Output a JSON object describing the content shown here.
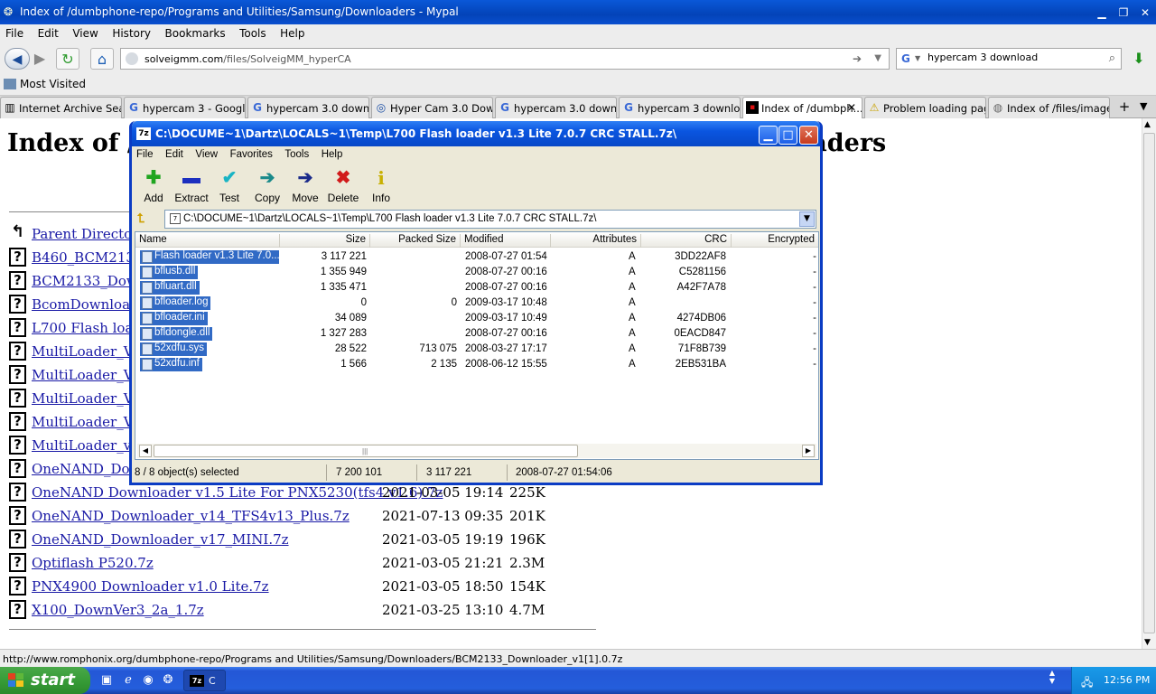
{
  "browser": {
    "title": "Index of /dumbphone-repo/Programs and Utilities/Samsung/Downloaders - Mypal",
    "menu": [
      "File",
      "Edit",
      "View",
      "History",
      "Bookmarks",
      "Tools",
      "Help"
    ],
    "url_domain": "solveigmm.com",
    "url_path": "/files/SolveigMM_hyperCA",
    "search_value": "hypercam 3 download",
    "bookmarks_label": "Most Visited",
    "tabs": [
      {
        "label": "Internet Archive Sear...",
        "icon": "archive-icon"
      },
      {
        "label": "hypercam 3 - Google ...",
        "icon": "google-icon"
      },
      {
        "label": "hypercam 3.0 downlo...",
        "icon": "google-icon"
      },
      {
        "label": "Hyper Cam 3.0 Down...",
        "icon": "site-icon"
      },
      {
        "label": "hypercam 3.0 downlo...",
        "icon": "google-icon"
      },
      {
        "label": "hypercam 3 downloa...",
        "icon": "google-icon"
      },
      {
        "label": "Index of /dumbph...",
        "icon": "site-icon",
        "active": true
      },
      {
        "label": "Problem loading page",
        "icon": "warning-icon"
      },
      {
        "label": "Index of /files/images/",
        "icon": "globe-icon"
      }
    ],
    "status_url": "http://www.romphonix.org/dumbphone-repo/Programs and Utilities/Samsung/Downloaders/BCM2133_Downloader_v1[1].0.7z"
  },
  "page": {
    "heading_left": "Index of /d",
    "heading_right": "loaders",
    "rows": [
      {
        "name": "Parent Directory",
        "date": "",
        "size": ""
      },
      {
        "name": "B460_BCM2133",
        "date": "",
        "size": ""
      },
      {
        "name": "BCM2133_Dow",
        "date": "",
        "size": ""
      },
      {
        "name": "BcomDownloade",
        "date": "",
        "size": ""
      },
      {
        "name": "L700 Flash loader",
        "date": "",
        "size": ""
      },
      {
        "name": "MultiLoader_V5.",
        "date": "",
        "size": ""
      },
      {
        "name": "MultiLoader_V5.",
        "date": "",
        "size": ""
      },
      {
        "name": "MultiLoader_V5.",
        "date": "",
        "size": ""
      },
      {
        "name": "MultiLoader_V5.",
        "date": "",
        "size": ""
      },
      {
        "name": "MultiLoader_v5.3",
        "date": "",
        "size": ""
      },
      {
        "name": "OneNAND_Dow",
        "date": "",
        "size": ""
      },
      {
        "name": "OneNAND Downloader v1.5 Lite For PNX5230(tfs4 v1.6).7z",
        "date": "2021-03-05 19:14",
        "size": "225K"
      },
      {
        "name": "OneNAND_Downloader_v14_TFS4v13_Plus.7z",
        "date": "2021-07-13 09:35",
        "size": "201K"
      },
      {
        "name": "OneNAND_Downloader_v17_MINI.7z",
        "date": "2021-03-05 19:19",
        "size": "196K"
      },
      {
        "name": "Optiflash P520.7z",
        "date": "2021-03-05 21:21",
        "size": "2.3M"
      },
      {
        "name": "PNX4900 Downloader v1.0 Lite.7z",
        "date": "2021-03-05 18:50",
        "size": "154K"
      },
      {
        "name": "X100_DownVer3_2a_1.7z",
        "date": "2021-03-25 13:10",
        "size": "4.7M"
      }
    ]
  },
  "sevenzip": {
    "title": "C:\\DOCUME~1\\Dartz\\LOCALS~1\\Temp\\L700 Flash loader v1.3 Lite 7.0.7 CRC STALL.7z\\",
    "menu": [
      "File",
      "Edit",
      "View",
      "Favorites",
      "Tools",
      "Help"
    ],
    "toolbar": [
      {
        "label": "Add",
        "icon": "plus-icon",
        "glyph": "✚",
        "color": "#1fa51f"
      },
      {
        "label": "Extract",
        "icon": "minus-icon",
        "glyph": "▬",
        "color": "#1c2fbf"
      },
      {
        "label": "Test",
        "icon": "check-icon",
        "glyph": "✔",
        "color": "#19b4c4"
      },
      {
        "label": "Copy",
        "icon": "copy-arrow-icon",
        "glyph": "➔",
        "color": "#1a8a8a"
      },
      {
        "label": "Move",
        "icon": "move-arrow-icon",
        "glyph": "➔",
        "color": "#1a2a8a"
      },
      {
        "label": "Delete",
        "icon": "delete-x-icon",
        "glyph": "✖",
        "color": "#d11a1a"
      },
      {
        "label": "Info",
        "icon": "info-icon",
        "glyph": "i",
        "color": "#c8b000"
      }
    ],
    "path": "C:\\DOCUME~1\\Dartz\\LOCALS~1\\Temp\\L700 Flash loader v1.3 Lite 7.0.7 CRC STALL.7z\\",
    "columns": [
      "Name",
      "Size",
      "Packed Size",
      "Modified",
      "Attributes",
      "CRC",
      "Encrypted"
    ],
    "files": [
      {
        "name": "Flash loader v1.3 Lite 7.0...",
        "size": "3 117 221",
        "packed": "",
        "modified": "2008-07-27 01:54",
        "attr": "A",
        "crc": "3DD22AF8",
        "enc": "-"
      },
      {
        "name": "bflusb.dll",
        "size": "1 355 949",
        "packed": "",
        "modified": "2008-07-27 00:16",
        "attr": "A",
        "crc": "C5281156",
        "enc": "-"
      },
      {
        "name": "bfluart.dll",
        "size": "1 335 471",
        "packed": "",
        "modified": "2008-07-27 00:16",
        "attr": "A",
        "crc": "A42F7A78",
        "enc": "-"
      },
      {
        "name": "bfloader.log",
        "size": "0",
        "packed": "0",
        "modified": "2009-03-17 10:48",
        "attr": "A",
        "crc": "",
        "enc": "-"
      },
      {
        "name": "bfloader.ini",
        "size": "34 089",
        "packed": "",
        "modified": "2009-03-17 10:49",
        "attr": "A",
        "crc": "4274DB06",
        "enc": "-"
      },
      {
        "name": "bfldongle.dll",
        "size": "1 327 283",
        "packed": "",
        "modified": "2008-07-27 00:16",
        "attr": "A",
        "crc": "0EACD847",
        "enc": "-"
      },
      {
        "name": "52xdfu.sys",
        "size": "28 522",
        "packed": "713 075",
        "modified": "2008-03-27 17:17",
        "attr": "A",
        "crc": "71F8B739",
        "enc": "-"
      },
      {
        "name": "52xdfu.inf",
        "size": "1 566",
        "packed": "2 135",
        "modified": "2008-06-12 15:55",
        "attr": "A",
        "crc": "2EB531BA",
        "enc": "-"
      }
    ],
    "status": {
      "selected": "8 / 8 object(s) selected",
      "total_size": "7 200 101",
      "sel_size": "3 117 221",
      "sel_date": "2008-07-27 01:54:06"
    }
  },
  "taskbar": {
    "start_label": "start",
    "task_label": "C",
    "clock": "12:56 PM"
  }
}
